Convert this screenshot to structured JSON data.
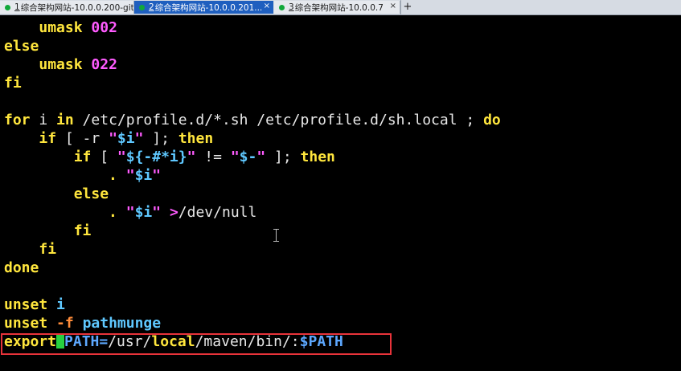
{
  "tabs": [
    {
      "number": "1",
      "title": "综合架构网站-10.0.0.200-git",
      "state": "inactive"
    },
    {
      "number": "2",
      "title": "综合架构网站-10.0.0.201...",
      "state": "active"
    },
    {
      "number": "3",
      "title": "综合架构网站-10.0.0.7",
      "state": "inactive"
    }
  ],
  "tab_close_glyph": "×",
  "tab_add_glyph": "+",
  "code": {
    "l1": {
      "kw": "umask",
      "num": "002"
    },
    "l2": {
      "kw": "else"
    },
    "l3": {
      "kw": "umask",
      "num": "022"
    },
    "l4": {
      "kw": "fi"
    },
    "l6": {
      "kw_for": "for",
      "var_i": " i ",
      "kw_in": "in",
      "paths": " /etc/profile.d/*.sh /etc/profile.d/sh.local ; ",
      "kw_do": "do"
    },
    "l7": {
      "kw_if": "if",
      "p1": " [ -r ",
      "q1": "\"",
      "var": "$i",
      "q2": "\"",
      "p2": " ]; ",
      "kw_then": "then"
    },
    "l8": {
      "kw_if": "if",
      "p1": " [ ",
      "q1": "\"",
      "var": "${-#*i}",
      "q2": "\"",
      "p2": " != ",
      "q3": "\"",
      "var2": "$-",
      "q4": "\"",
      "p3": " ]; ",
      "kw_then": "then"
    },
    "l9": {
      "dot": ".",
      "sp": " ",
      "q1": "\"",
      "var": "$i",
      "q2": "\""
    },
    "l10": {
      "kw": "else"
    },
    "l11": {
      "dot": ".",
      "sp": " ",
      "q1": "\"",
      "var": "$i",
      "q2": "\"",
      "redir_op": " >",
      "redir_path": "/dev/null"
    },
    "l12": {
      "kw": "fi"
    },
    "l13": {
      "kw": "fi"
    },
    "l14": {
      "kw": "done"
    },
    "l16": {
      "kw": "unset",
      "arg": "i"
    },
    "l17": {
      "kw": "unset",
      "flag": "-f",
      "arg": "pathmunge"
    },
    "l18": {
      "kw": "export",
      "var": "PATH=",
      "p1": "/usr/",
      "local": "local",
      "p2": "/maven/bin/:",
      "ref": "$PATH"
    }
  },
  "colors": {
    "keyword": "#ffe63d",
    "number": "#ff5bff",
    "variable": "#5fc8ff",
    "flag": "#ff8c3a",
    "cursor": "#27d140",
    "highlight": "#e8333a",
    "active_tab": "#1f5fbf"
  }
}
